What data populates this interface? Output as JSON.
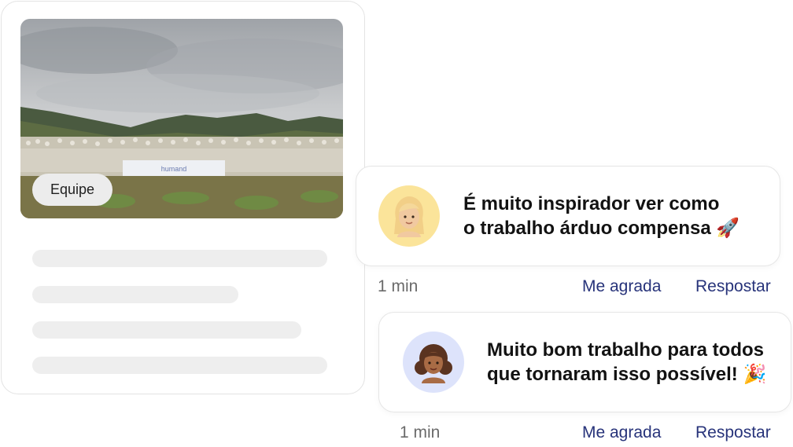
{
  "post": {
    "tag_label": "Equipe",
    "banner_text": "humand"
  },
  "comments": [
    {
      "line1": "É muito inspirador ver como",
      "line2": "o trabalho árduo compensa",
      "emoji": "🚀",
      "time": "1 min",
      "like_label": "Me agrada",
      "reply_label": "Respostar",
      "avatar_bg": "#fbe49a"
    },
    {
      "line1": "Muito bom trabalho para todos",
      "line2": "que tornaram isso possível!",
      "emoji": "🎉",
      "time": "1 min",
      "like_label": "Me agrada",
      "reply_label": "Respostar",
      "avatar_bg": "#dde3fb"
    }
  ],
  "colors": {
    "link": "#27337a",
    "meta": "#6a6a6a",
    "skeleton": "#eeeeee"
  }
}
